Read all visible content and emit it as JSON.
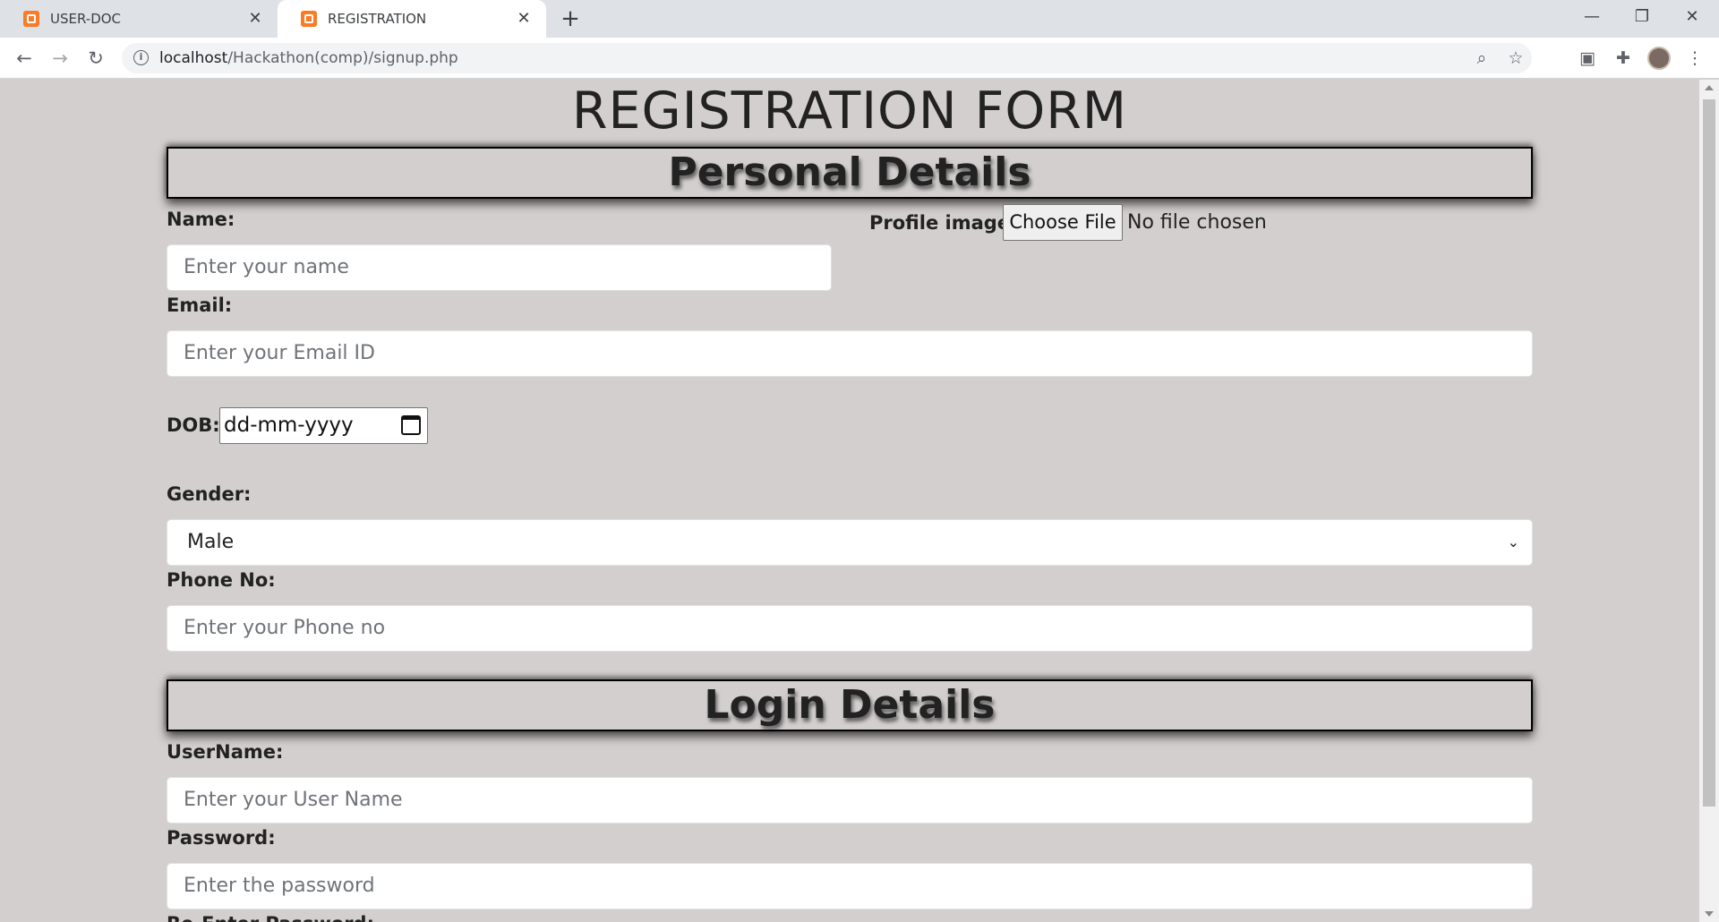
{
  "browser": {
    "tabs": [
      {
        "label": "USER-DOC",
        "active": false
      },
      {
        "label": "REGISTRATION",
        "active": true
      }
    ],
    "url_host": "localhost",
    "url_path": "/Hackathon(comp)/signup.php"
  },
  "page": {
    "title": "REGISTRATION FORM",
    "personal_section": "Personal Details",
    "login_section": "Login Details",
    "name_label": "Name:",
    "name_placeholder": "Enter your name",
    "profile_label": "Profile image:",
    "file_button": "Choose File",
    "file_status": "No file chosen",
    "email_label": "Email:",
    "email_placeholder": "Enter your Email ID",
    "dob_label": "DOB:",
    "dob_placeholder": "dd-mm-yyyy",
    "gender_label": "Gender:",
    "gender_value": "Male",
    "phone_label": "Phone No:",
    "phone_placeholder": "Enter your Phone no",
    "username_label": "UserName:",
    "username_placeholder": "Enter your User Name",
    "password_label": "Password:",
    "password_placeholder": "Enter the password",
    "reenter_label": "Re-Enter Password:"
  },
  "colors": {
    "page_background": "#d3cfcf",
    "tab_favicon": "#fb7a24"
  }
}
